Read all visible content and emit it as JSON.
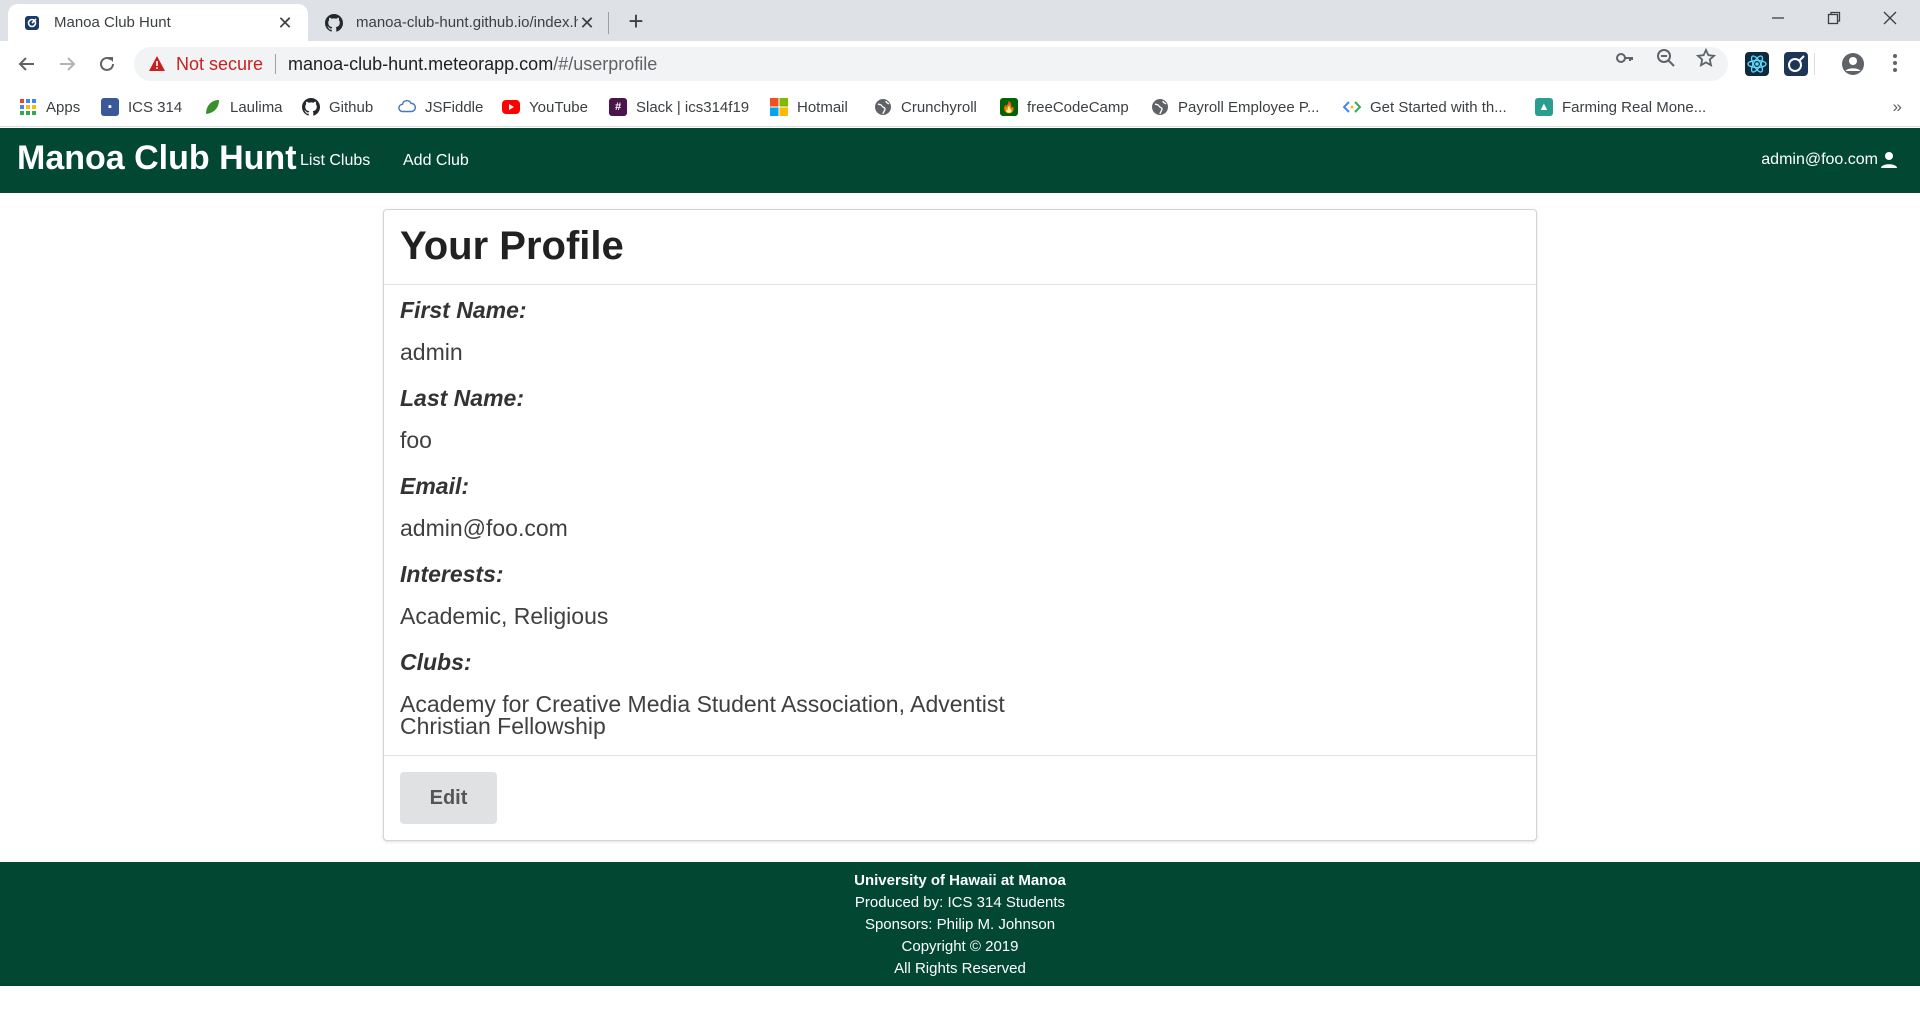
{
  "browser": {
    "tabs": [
      {
        "title": "Manoa Club Hunt",
        "active": true
      },
      {
        "title": "manoa-club-hunt.github.io/index.html",
        "active": false
      }
    ],
    "address": {
      "security_label": "Not secure",
      "host": "manoa-club-hunt.meteorapp.com",
      "path": "/#/userprofile"
    },
    "bookmarks": [
      {
        "label": "Apps",
        "icon": "apps-grid-icon",
        "color": "#4285f4"
      },
      {
        "label": "ICS 314",
        "icon": "ics-icon",
        "color": "#3b5998"
      },
      {
        "label": "Laulima",
        "icon": "laulima-leaf-icon",
        "color": "#3a8f2e"
      },
      {
        "label": "Github",
        "icon": "github-icon",
        "color": "#24292e"
      },
      {
        "label": "JSFiddle",
        "icon": "cloud-icon",
        "color": "#4679bd"
      },
      {
        "label": "YouTube",
        "icon": "youtube-icon",
        "color": "#ff0000"
      },
      {
        "label": "Slack | ics314f19",
        "icon": "slack-icon",
        "color": "#4a154b"
      },
      {
        "label": "Hotmail",
        "icon": "microsoft-icon",
        "color": "#f25022"
      },
      {
        "label": "Crunchyroll",
        "icon": "globe-icon",
        "color": "#5f6368"
      },
      {
        "label": "freeCodeCamp",
        "icon": "fcc-icon",
        "color": "#006400"
      },
      {
        "label": "Payroll Employee P...",
        "icon": "globe-icon",
        "color": "#5f6368"
      },
      {
        "label": "Get Started with th...",
        "icon": "code-icon",
        "color": "#34a853"
      },
      {
        "label": "Farming Real Mone...",
        "icon": "farm-icon",
        "color": "#2a9d8f"
      }
    ]
  },
  "navbar": {
    "brand": "Manoa Club Hunt",
    "links": [
      "List Clubs",
      "Add Club"
    ],
    "user": "admin@foo.com"
  },
  "profile": {
    "title": "Your Profile",
    "fields": [
      {
        "label": "First Name:",
        "value": "admin"
      },
      {
        "label": "Last Name:",
        "value": "foo"
      },
      {
        "label": "Email:",
        "value": "admin@foo.com"
      },
      {
        "label": "Interests:",
        "value": "Academic, Religious"
      },
      {
        "label": "Clubs:",
        "value": "Academy for Creative Media Student Association, Adventist Christian Fellowship"
      }
    ],
    "edit_label": "Edit"
  },
  "footer": {
    "lines": [
      "University of Hawaii at Manoa",
      "Produced by: ICS 314 Students",
      "Sponsors: Philip M. Johnson",
      "Copyright © 2019",
      "All Rights Reserved"
    ]
  },
  "colors": {
    "brand_green": "#024731",
    "button_gray": "#e0e1e2",
    "not_secure_red": "#c5221f"
  }
}
